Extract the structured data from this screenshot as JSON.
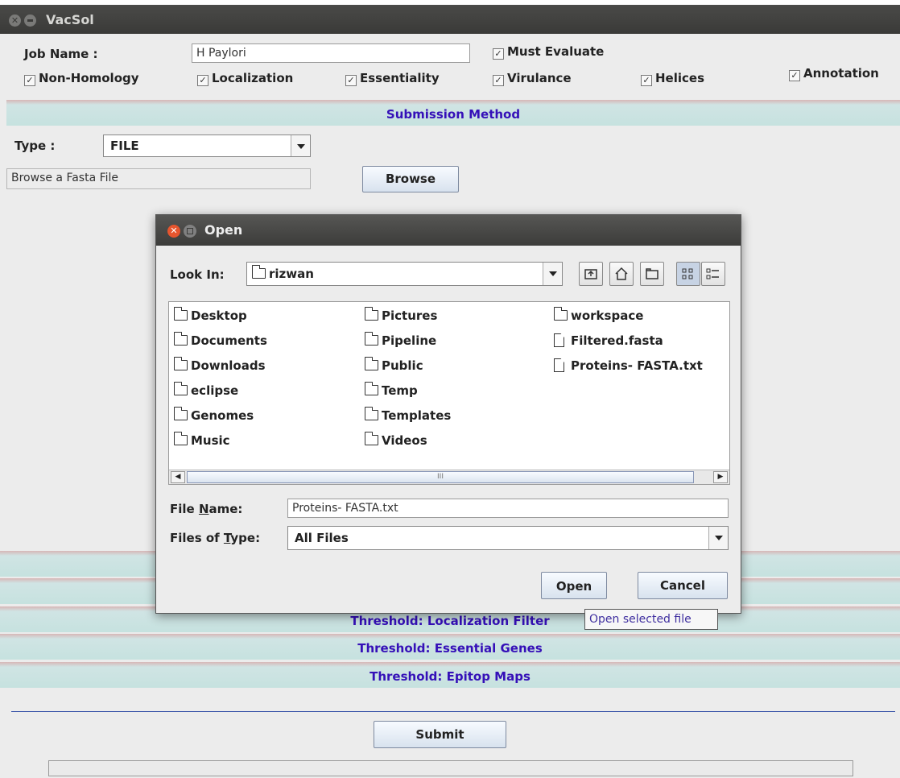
{
  "app": {
    "title": "VacSol"
  },
  "job": {
    "label": "Job Name :",
    "value": "H Paylori",
    "must_evaluate": "Must Evaluate"
  },
  "options": [
    {
      "label": "Non-Homology",
      "checked": true
    },
    {
      "label": "Localization",
      "checked": true
    },
    {
      "label": "Essentiality",
      "checked": true
    },
    {
      "label": "Virulance",
      "checked": true
    },
    {
      "label": "Helices",
      "checked": true
    },
    {
      "label": "Annotation",
      "checked": true
    }
  ],
  "submission": {
    "header": "Submission Method",
    "type_label": "Type :",
    "type_value": "FILE",
    "file_field": "Browse a Fasta File",
    "browse_label": "Browse"
  },
  "thresholds": [
    "Threshold: Localization Filter",
    "Threshold: Essential Genes",
    "Threshold: Epitop Maps"
  ],
  "submit_label": "Submit",
  "dialog": {
    "title": "Open",
    "look_in_label": "Look In:",
    "look_in_value": "rizwan",
    "files": [
      {
        "name": "Desktop",
        "kind": "folder"
      },
      {
        "name": "Documents",
        "kind": "folder"
      },
      {
        "name": "Downloads",
        "kind": "folder"
      },
      {
        "name": "eclipse",
        "kind": "folder"
      },
      {
        "name": "Genomes",
        "kind": "folder"
      },
      {
        "name": "Music",
        "kind": "folder"
      },
      {
        "name": "Pictures",
        "kind": "folder"
      },
      {
        "name": "Pipeline",
        "kind": "folder"
      },
      {
        "name": "Public",
        "kind": "folder"
      },
      {
        "name": "Temp",
        "kind": "folder"
      },
      {
        "name": "Templates",
        "kind": "folder"
      },
      {
        "name": "Videos",
        "kind": "folder"
      },
      {
        "name": "workspace",
        "kind": "folder"
      },
      {
        "name": "Filtered.fasta",
        "kind": "file"
      },
      {
        "name": "Proteins- FASTA.txt",
        "kind": "file"
      }
    ],
    "file_name_label": "File Name:",
    "file_name_value": "Proteins- FASTA.txt",
    "files_of_type_label": "Files of Type:",
    "files_of_type_value": "All Files",
    "open_label": "Open",
    "cancel_label": "Cancel",
    "tooltip": "Open selected file",
    "scroll_grip": "III"
  }
}
